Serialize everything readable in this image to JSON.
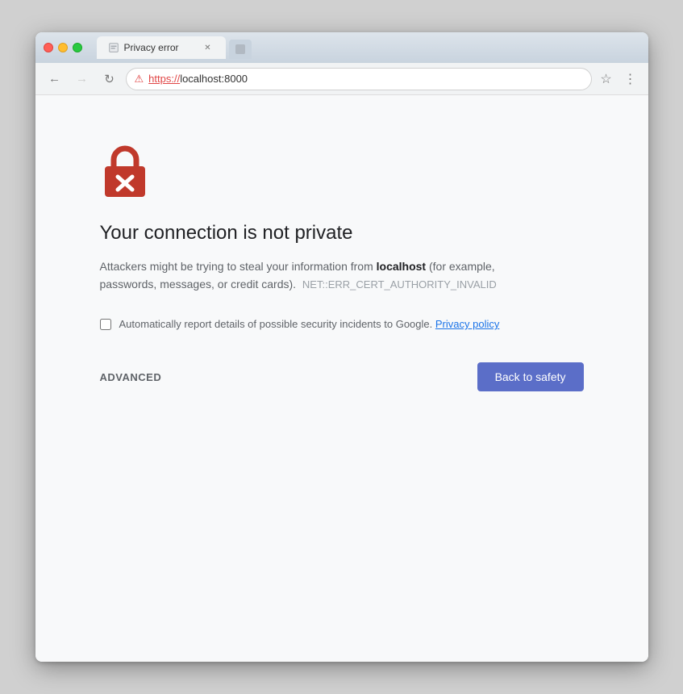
{
  "browser": {
    "title": "Privacy error",
    "tab_label": "Privacy error",
    "address": "https://localhost:8000",
    "protocol": "https://",
    "host": "localhost:8000"
  },
  "nav": {
    "back_label": "←",
    "forward_label": "→",
    "reload_label": "↻"
  },
  "error_page": {
    "heading": "Your connection is not private",
    "description_before": "Attackers might be trying to steal your information from ",
    "description_domain": "localhost",
    "description_after": " (for example, passwords, messages, or credit cards).",
    "error_code": "NET::ERR_CERT_AUTHORITY_INVALID",
    "checkbox_label": "Automatically report details of possible security incidents to Google.",
    "privacy_policy_label": "Privacy policy",
    "advanced_label": "ADVANCED",
    "back_to_safety_label": "Back to safety"
  }
}
